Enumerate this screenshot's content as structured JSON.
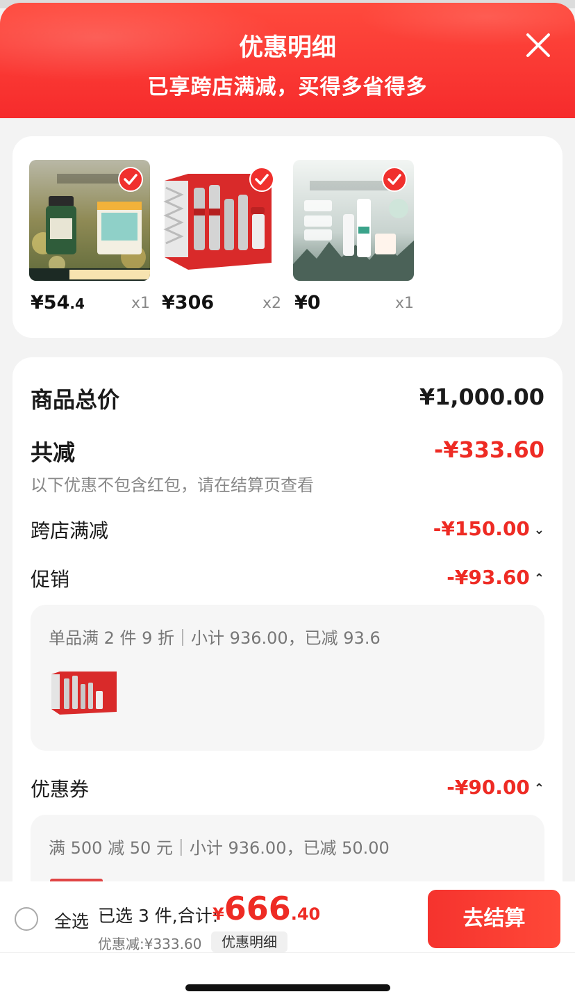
{
  "header": {
    "title": "优惠明细",
    "subtitle": "已享跨店满减，买得多省得多"
  },
  "products": [
    {
      "price_int": "¥54",
      "price_dec": ".4",
      "qty": "x1",
      "image": "essential-oil-product-image"
    },
    {
      "price_int": "¥306",
      "price_dec": "",
      "qty": "x2",
      "image": "skincare-gift-set-image"
    },
    {
      "price_int": "¥0",
      "price_dec": "",
      "qty": "x1",
      "image": "whitening-serum-image"
    }
  ],
  "summary": {
    "total_label": "商品总价",
    "total_value": "¥1,000.00",
    "reduced_label": "共减",
    "reduced_value": "-¥333.60",
    "reduced_note": "以下优惠不包含红包，请在结算页查看",
    "cross_store_label": "跨店满减",
    "cross_store_value": "-¥150.00",
    "promo_label": "促销",
    "promo_value": "-¥93.60",
    "promo_detail": "单品满 2 件 9 折｜小计 936.00，已减 93.6",
    "coupon_label": "优惠券",
    "coupon_value": "-¥90.00",
    "coupon_detail": "满 500 减 50 元｜小计 936.00，已减 50.00"
  },
  "bottom": {
    "select_all": "全选",
    "selected_text": "已选 3 件,合计:",
    "total_currency": "¥",
    "total_int": "666",
    "total_dec": ".40",
    "discount_text": "优惠减:¥333.60",
    "detail_button": "优惠明细",
    "checkout_button": "去结算"
  },
  "colors": {
    "accent": "#ee2b24",
    "header_red": "#f62b2c"
  }
}
